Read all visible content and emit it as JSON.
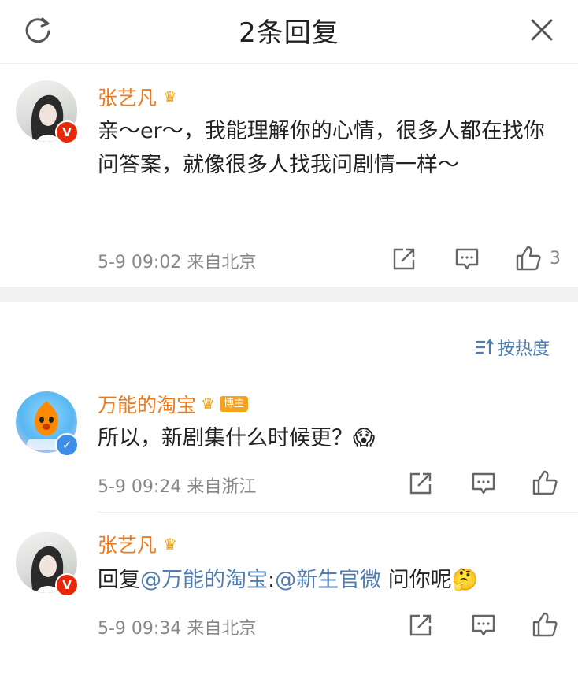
{
  "header": {
    "title": "2条回复"
  },
  "main_comment": {
    "user": "张艺凡",
    "text": "亲～er～，我能理解你的心情，很多人都在找你问答案，就像很多人找我问剧情一样～",
    "time": "5-9 09:02",
    "location": "来自北京",
    "like_count": "3"
  },
  "sort": {
    "label": "按热度"
  },
  "replies": [
    {
      "user": "万能的淘宝",
      "badge": "博主",
      "text": "所以，新剧集什么时候更？",
      "emoji": "😱",
      "time": "5-9 09:24",
      "location": "来自浙江"
    },
    {
      "user": "张艺凡",
      "prefix": "回复",
      "mention1": "@万能的淘宝",
      "colon": ":",
      "mention2": "@新生官微",
      "suffix": " 问你呢",
      "emoji": "🤔",
      "time": "5-9 09:34",
      "location": "来自北京"
    }
  ],
  "colors": {
    "username": "#ef7a1c",
    "link": "#507daf",
    "meta": "#888888"
  }
}
